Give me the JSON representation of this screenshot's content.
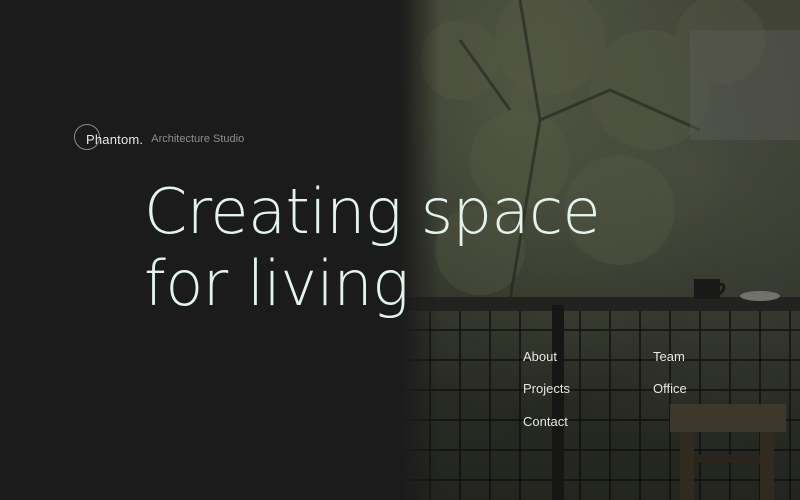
{
  "logo": {
    "name": "Phantom.",
    "tagline": "Architecture Studio"
  },
  "hero": {
    "line1": "Creating space",
    "line2": "for living"
  },
  "nav": {
    "about": "About",
    "team": "Team",
    "projects": "Projects",
    "office": "Office",
    "contact": "Contact"
  },
  "colors": {
    "background": "#1b1b1b",
    "headline": "#e3f4ee",
    "nav_text": "#e8e8e2",
    "tagline": "#8f8f8a"
  }
}
